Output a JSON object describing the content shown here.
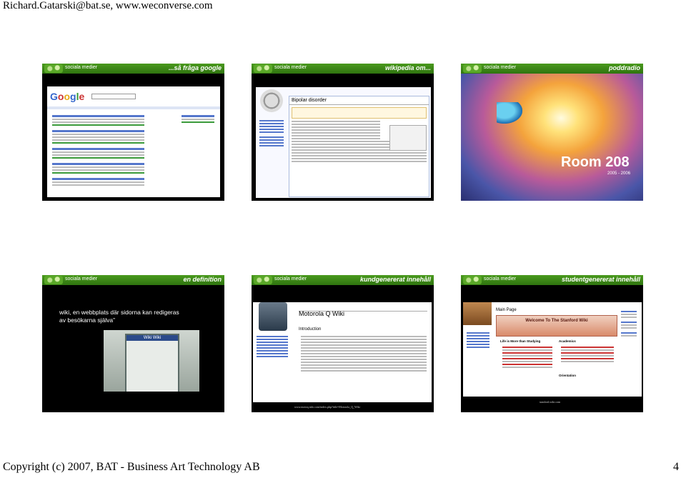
{
  "header": {
    "text": "Richard.Gatarski@bat.se, www.weconverse.com"
  },
  "footer": {
    "text": "Copyright (c) 2007, BAT - Business Art Technology AB",
    "page_number": "4"
  },
  "slide_site_label": "sociala medier",
  "slides": [
    {
      "title": "...så fråga google"
    },
    {
      "title": "wikipedia om..."
    },
    {
      "title": "poddradio",
      "room_title": "Room 208",
      "room_years": "2005 - 2006"
    },
    {
      "title": "en definition",
      "definition": "wiki, en webbplats där sidorna kan redigeras av besökarna själva”",
      "sign_text": "Wiki Wiki"
    },
    {
      "title": "kundgenererat innehåll",
      "wiki_title": "Motorola Q Wiki",
      "intro": "Introduction",
      "url": "www.motoq.info.com/index.php?title=Motorola_Q_Wiki"
    },
    {
      "title": "studentgenererat innehåll",
      "wiki_title": "Welcome To The Stanford Wiki",
      "main_page": "Main Page",
      "life": "Life is More than Studying",
      "academics": "Academics",
      "orientation": "Orientation",
      "url": "stanford.wiki.com"
    }
  ],
  "colors": {
    "bar": "#3a8a18",
    "slide_bg": "#000000",
    "accent_blue": "#2233aa"
  }
}
